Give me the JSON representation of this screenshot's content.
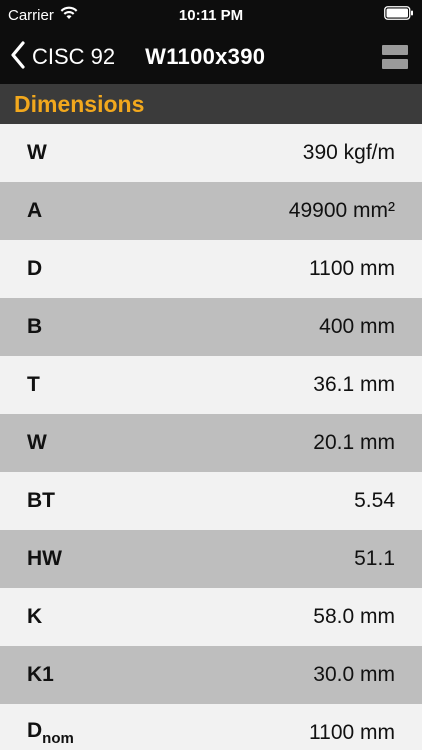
{
  "status_bar": {
    "carrier": "Carrier",
    "time": "10:11 PM",
    "wifi_icon": "wifi-icon",
    "battery_icon": "battery-icon"
  },
  "nav": {
    "back_label": "CISC 92",
    "title": "W1100x390",
    "back_icon": "chevron-left-icon",
    "menu_icon": "menu-icon"
  },
  "section": {
    "title": "Dimensions",
    "title_color": "#f2a81d"
  },
  "rows": [
    {
      "key": "W",
      "sub": "",
      "value": "390 kgf/m"
    },
    {
      "key": "A",
      "sub": "",
      "value": "49900 mm²"
    },
    {
      "key": "D",
      "sub": "",
      "value": "1100 mm"
    },
    {
      "key": "B",
      "sub": "",
      "value": "400 mm"
    },
    {
      "key": "T",
      "sub": "",
      "value": "36.1 mm"
    },
    {
      "key": "W",
      "sub": "",
      "value": "20.1 mm"
    },
    {
      "key": "BT",
      "sub": "",
      "value": "5.54"
    },
    {
      "key": "HW",
      "sub": "",
      "value": "51.1"
    },
    {
      "key": "K",
      "sub": "",
      "value": "58.0 mm"
    },
    {
      "key": "K1",
      "sub": "",
      "value": "30.0 mm"
    },
    {
      "key": "D",
      "sub": "nom",
      "value": "1100 mm"
    }
  ]
}
